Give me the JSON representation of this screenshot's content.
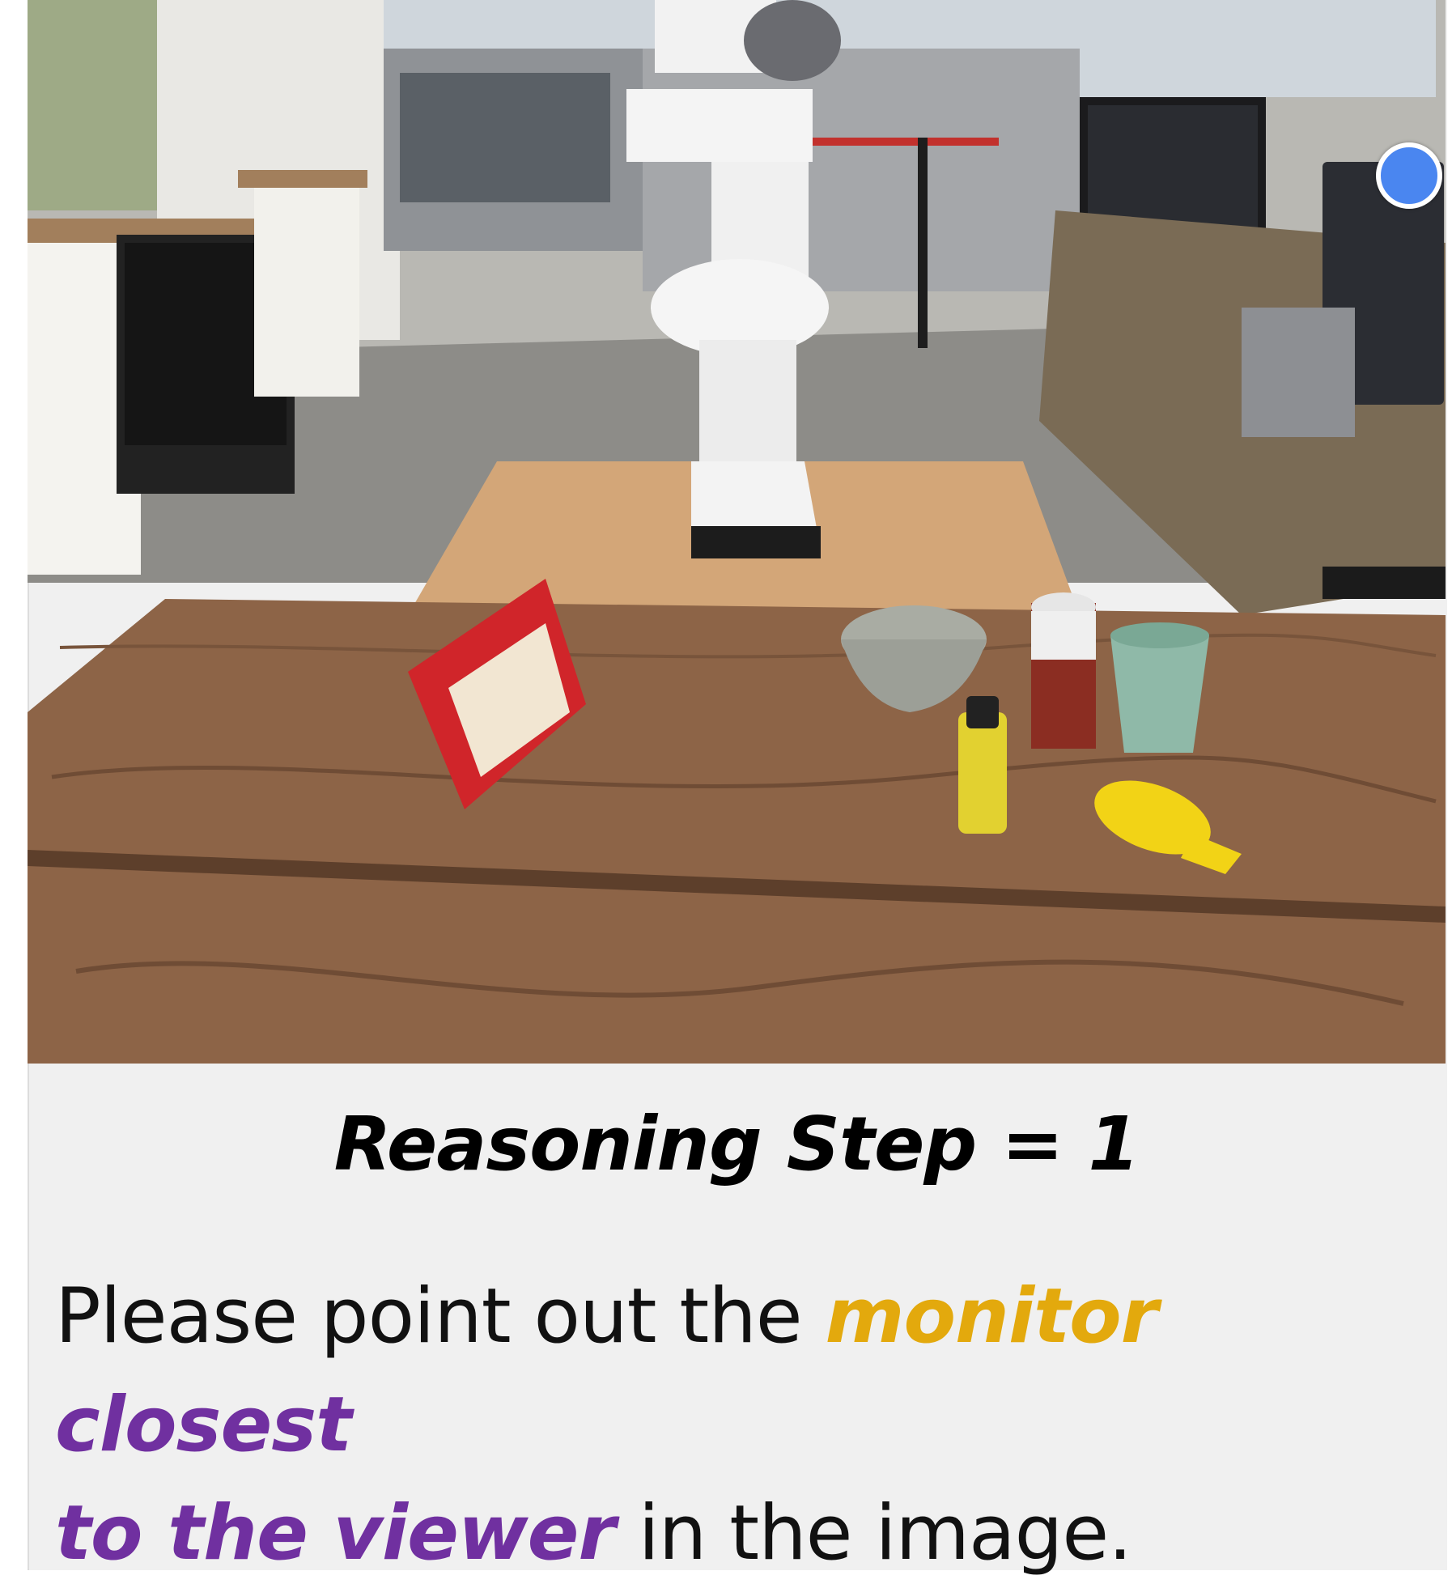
{
  "image": {
    "alt_objects": [
      "robot-arm",
      "cereal-box",
      "bowl",
      "can",
      "cup",
      "mustard-bottle",
      "monitor"
    ]
  },
  "marker": {
    "color": "#4a86f0"
  },
  "heading": {
    "text": "Reasoning Step = 1"
  },
  "prompt": {
    "prefix": "Please point out the ",
    "object": "monitor",
    "space": " ",
    "relation_line1": "closest",
    "relation_line2": "to the viewer",
    "suffix": " in the image.",
    "object_color": "#e3a90d",
    "relation_color": "#7030a0"
  }
}
